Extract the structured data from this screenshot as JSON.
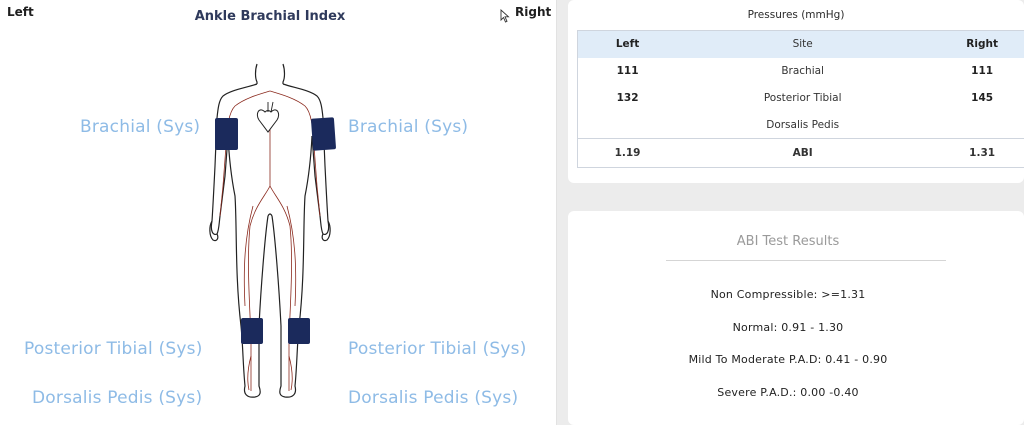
{
  "diagram": {
    "left_label": "Left",
    "title": "Ankle Brachial Index",
    "right_label": "Right",
    "labels": {
      "brachial_left": "Brachial (Sys)",
      "brachial_right": "Brachial (Sys)",
      "posterior_tibial_left": "Posterior Tibial (Sys)",
      "posterior_tibial_right": "Posterior Tibial (Sys)",
      "dorsalis_pedis_left": "Dorsalis Pedis (Sys)",
      "dorsalis_pedis_right": "Dorsalis Pedis (Sys)"
    },
    "cuff_color": "#1b2a5c",
    "artery_color": "#8b2a1e",
    "label_color": "#8ebbe6"
  },
  "pressures": {
    "title": "Pressures (mmHg)",
    "headers": {
      "left": "Left",
      "site": "Site",
      "right": "Right"
    },
    "rows": [
      {
        "left": "111",
        "site": "Brachial",
        "right": "111"
      },
      {
        "left": "132",
        "site": "Posterior Tibial",
        "right": "145"
      },
      {
        "left": "",
        "site": "Dorsalis Pedis",
        "right": ""
      }
    ],
    "abi": {
      "left": "1.19",
      "site": "ABI",
      "right": "1.31"
    }
  },
  "results": {
    "title": "ABI Test Results",
    "lines": [
      "Non Compressible: >=1.31",
      "Normal: 0.91 - 1.30",
      "Mild To Moderate P.A.D: 0.41 - 0.90",
      "Severe P.A.D.: 0.00 -0.40"
    ]
  },
  "icons": {
    "cursor": "mouse-pointer-icon",
    "body": "human-body-icon",
    "heart": "heart-icon"
  }
}
